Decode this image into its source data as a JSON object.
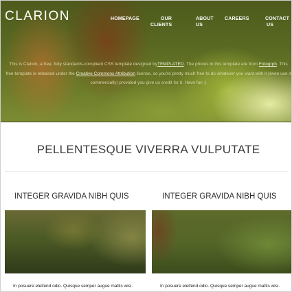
{
  "header": {
    "logo": "CLARION",
    "nav": [
      {
        "line1": "HOMEPAGE",
        "line2": ""
      },
      {
        "line1": "OUR",
        "line2": "CLIENTS"
      },
      {
        "line1": "ABOUT",
        "line2": "US"
      },
      {
        "line1": "CAREERS",
        "line2": ""
      },
      {
        "line1": "CONTACT",
        "line2": "US"
      }
    ],
    "intro": {
      "t1": "This is Clarion, a free, fully standards-compliant CSS template designed by",
      "link1": "TEMPLATED",
      "t2": ". The photos in this template are from ",
      "link2": "Fotogrph",
      "t3": ". This free template is released under the ",
      "link3": "Creative Commons Attribution",
      "t4": " license, so you're pretty much free to do whatever you want with it (even use it commercially) provided you give us credit for it. Have fun :)"
    }
  },
  "main": {
    "title": "PELLENTESQUE VIVERRA VULPUTATE",
    "columns": [
      {
        "title": "INTEGER GRAVIDA NIBH QUIS",
        "text": "In posuere eleifend odio. Quisque semper augue mattis wisi."
      },
      {
        "title": "INTEGER GRAVIDA NIBH QUIS",
        "text": "In posuere eleifend odio. Quisque semper augue mattis wisi."
      }
    ]
  }
}
